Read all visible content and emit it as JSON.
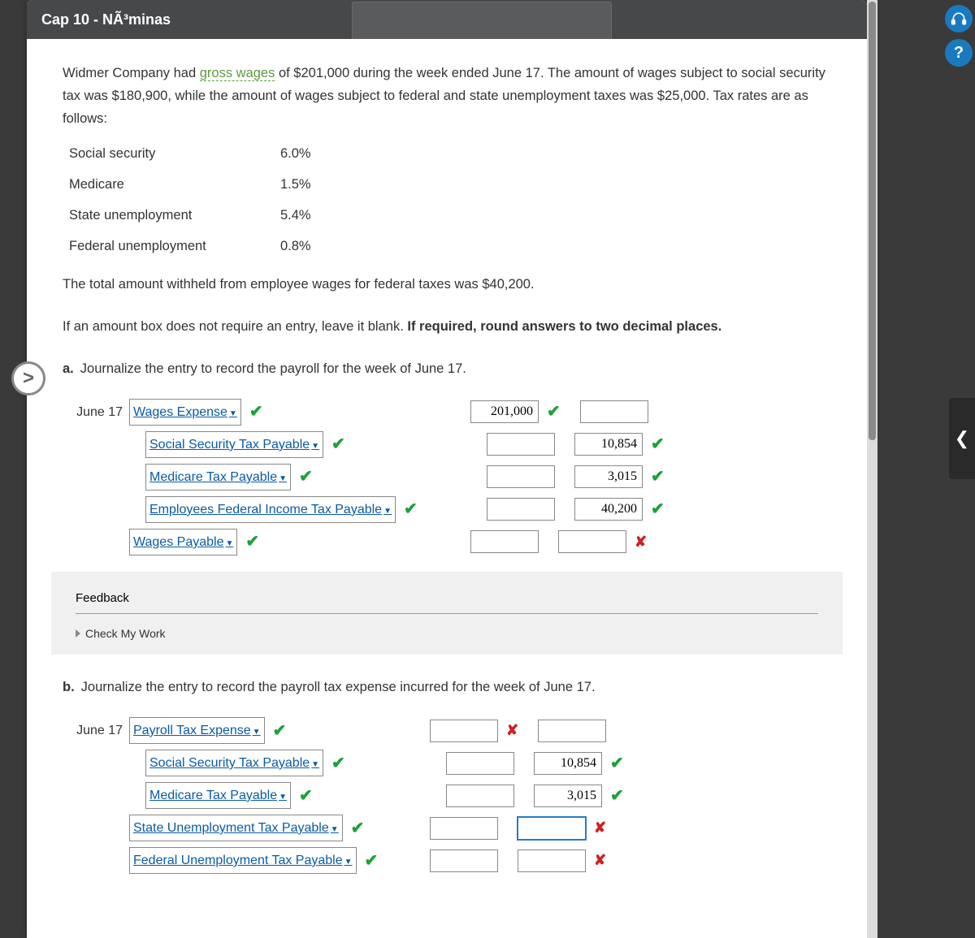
{
  "header": {
    "title": "Cap 10 - NÃ³minas"
  },
  "intro": {
    "p1a": "Widmer Company had ",
    "gw": "gross wages",
    "p1b": " of $201,000 during the week ended June 17. The amount of wages subject to social security tax was $180,900, while the amount of wages subject to federal and state unemployment taxes was $25,000. Tax rates are as follows:"
  },
  "tax_rates": [
    {
      "label": "Social security",
      "rate": "6.0%"
    },
    {
      "label": "Medicare",
      "rate": "1.5%"
    },
    {
      "label": "State unemployment",
      "rate": "5.4%"
    },
    {
      "label": "Federal unemployment",
      "rate": "0.8%"
    }
  ],
  "withheld": "The total amount withheld from employee wages for federal taxes was $40,200.",
  "instr1": "If an amount box does not require an entry, leave it blank. ",
  "instr2": "If required, round answers to two decimal places.",
  "qa": {
    "letter": "a.",
    "text": "Journalize the entry to record the payroll for the week of June 17."
  },
  "qb": {
    "letter": "b.",
    "text": "Journalize the entry to record the payroll tax expense incurred for the week of June 17."
  },
  "date": "June 17",
  "journal_a": [
    {
      "acct": "Wages Expense",
      "acct_mark": "check",
      "indent": 0,
      "debit": "201,000",
      "d_mark": "check",
      "credit": "",
      "c_mark": ""
    },
    {
      "acct": "Social Security Tax Payable",
      "acct_mark": "check",
      "indent": 1,
      "debit": "",
      "d_mark": "",
      "credit": "10,854",
      "c_mark": "check"
    },
    {
      "acct": "Medicare Tax Payable",
      "acct_mark": "check",
      "indent": 1,
      "debit": "",
      "d_mark": "",
      "credit": "3,015",
      "c_mark": "check"
    },
    {
      "acct": "Employees Federal Income Tax Payable",
      "acct_mark": "check",
      "indent": 1,
      "debit": "",
      "d_mark": "",
      "credit": "40,200",
      "c_mark": "check"
    },
    {
      "acct": "Wages Payable",
      "acct_mark": "check",
      "indent": 0,
      "debit": "",
      "d_mark": "",
      "credit": "",
      "c_mark": "x"
    }
  ],
  "journal_b": [
    {
      "acct": "Payroll Tax Expense",
      "acct_mark": "check",
      "indent": 0,
      "debit": "",
      "d_mark": "x",
      "credit": "",
      "c_mark": ""
    },
    {
      "acct": "Social Security Tax Payable",
      "acct_mark": "check",
      "indent": 1,
      "debit": "",
      "d_mark": "",
      "credit": "10,854",
      "c_mark": "check"
    },
    {
      "acct": "Medicare Tax Payable",
      "acct_mark": "check",
      "indent": 1,
      "debit": "",
      "d_mark": "",
      "credit": "3,015",
      "c_mark": "check"
    },
    {
      "acct": "State Unemployment Tax Payable",
      "acct_mark": "check",
      "indent": 0,
      "debit": "",
      "d_mark": "",
      "credit": "",
      "c_mark": "x",
      "focus": true
    },
    {
      "acct": "Federal Unemployment Tax Payable",
      "acct_mark": "check",
      "indent": 0,
      "debit": "",
      "d_mark": "",
      "credit": "",
      "c_mark": "x"
    }
  ],
  "feedback": {
    "title": "Feedback",
    "cmw": "Check My Work"
  },
  "icons": {
    "headset": "headset-icon",
    "help": "?",
    "nav": ">",
    "drawer": "❮"
  }
}
